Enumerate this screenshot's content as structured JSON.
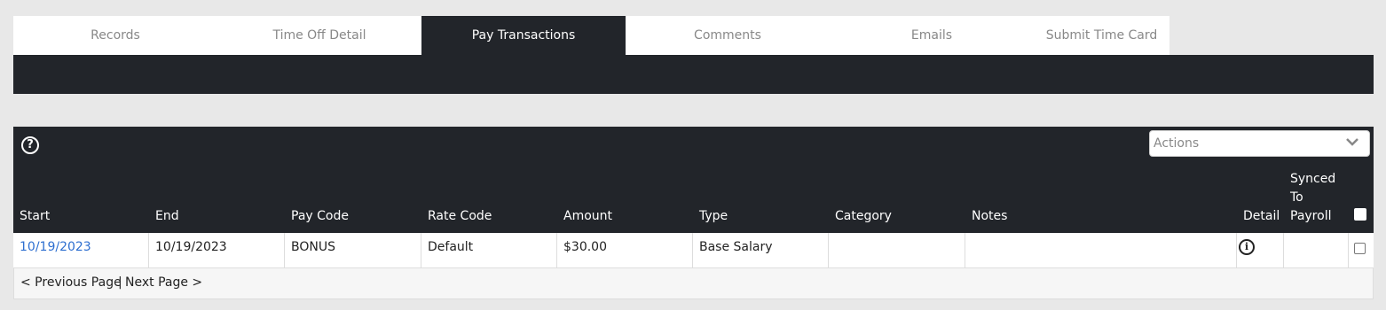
{
  "tabs": [
    {
      "label": "Records"
    },
    {
      "label": "Time Off Detail"
    },
    {
      "label": "Pay Transactions",
      "active": true
    },
    {
      "label": "Comments"
    },
    {
      "label": "Emails"
    },
    {
      "label": "Submit Time Card"
    }
  ],
  "toolbar": {
    "help_icon": "question-circle-icon",
    "help_glyph": "?",
    "actions_label": "Actions",
    "actions_icon": "chevron-down-icon"
  },
  "columns": {
    "start": "Start",
    "end": "End",
    "pay_code": "Pay Code",
    "rate_code": "Rate Code",
    "amount": "Amount",
    "type": "Type",
    "category": "Category",
    "notes": "Notes",
    "detail": "Detail",
    "synced_line1": "Synced",
    "synced_line2": "To",
    "synced_line3": "Payroll"
  },
  "rows": [
    {
      "start": "10/19/2023",
      "end": "10/19/2023",
      "pay_code": "BONUS",
      "rate_code": "Default",
      "amount": "$30.00",
      "type": "Base Salary",
      "category": "",
      "notes": "",
      "detail_icon": "info-circle-icon",
      "detail_glyph": "i"
    }
  ],
  "pager": {
    "previous": "< Previous Page",
    "separator": "|",
    "next": "Next Page >"
  },
  "colors": {
    "dark": "#22252a",
    "link": "#2e6fd0",
    "background": "#e8e8e8"
  }
}
